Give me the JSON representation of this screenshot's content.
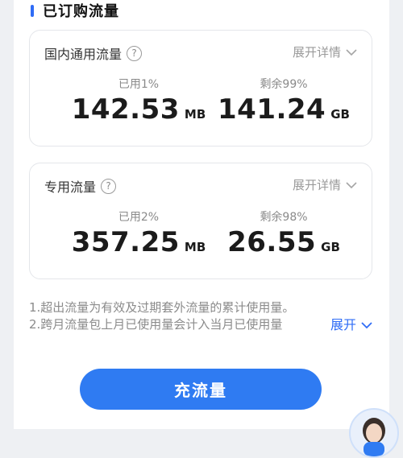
{
  "header": {
    "title": "已订购流量"
  },
  "cards": [
    {
      "name": "国内通用流量",
      "detail_label": "展开详情",
      "used": {
        "label": "已用1%",
        "value": "142.53",
        "unit": "MB"
      },
      "remaining": {
        "label": "剩余99%",
        "value": "141.24",
        "unit": "GB"
      }
    },
    {
      "name": "专用流量",
      "detail_label": "展开详情",
      "used": {
        "label": "已用2%",
        "value": "357.25",
        "unit": "MB"
      },
      "remaining": {
        "label": "剩余98%",
        "value": "26.55",
        "unit": "GB"
      }
    }
  ],
  "notes": {
    "line1": "1.超出流量为有效及过期套外流量的累计使用量。",
    "line2": "2.跨月流量包上月已使用量会计入当月已使用量",
    "expand_label": "展开"
  },
  "recharge_button": {
    "label": "充流量"
  },
  "colors": {
    "accent": "#2f7bf2",
    "muted": "#8b8b8b"
  },
  "icons": [
    "help-icon",
    "chevron-down-icon",
    "assistant-avatar"
  ]
}
